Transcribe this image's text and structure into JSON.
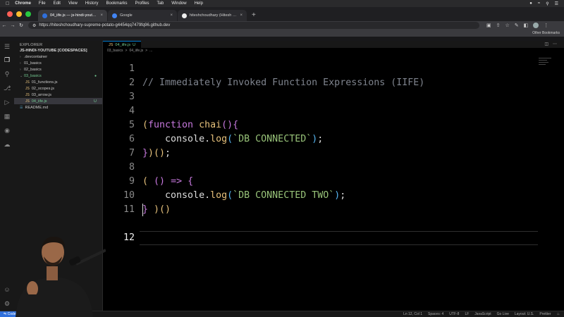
{
  "menubar": {
    "app": "Chrome",
    "items": [
      "File",
      "Edit",
      "View",
      "History",
      "Bookmarks",
      "Profiles",
      "Tab",
      "Window",
      "Help"
    ]
  },
  "tabs": [
    {
      "label": "04_iife.js — js-hindi-youtube [",
      "active": true
    },
    {
      "label": "Google",
      "active": false
    },
    {
      "label": "hiteshchoudhary (Hitesh Cho",
      "active": false
    }
  ],
  "address": {
    "url": "https://hiteshchoudhary-supreme-potato-g4454qq7479fq96.github.dev"
  },
  "bookmarks": {
    "other": "Other Bookmarks"
  },
  "explorer": {
    "title": "EXPLORER",
    "project": "JS-HINDI-YOUTUBE [CODESPACES]",
    "items": [
      {
        "label": ".devcontainer",
        "kind": "folder",
        "open": false,
        "indent": 1
      },
      {
        "label": "01_basics",
        "kind": "folder",
        "open": false,
        "indent": 1
      },
      {
        "label": "02_basics",
        "kind": "folder",
        "open": false,
        "indent": 1
      },
      {
        "label": "03_basics",
        "kind": "folder",
        "open": true,
        "indent": 1,
        "git": "green"
      },
      {
        "label": "01_functions.js",
        "kind": "file",
        "indent": 2
      },
      {
        "label": "02_scopes.js",
        "kind": "file",
        "indent": 2
      },
      {
        "label": "03_arrow.js",
        "kind": "file",
        "indent": 2
      },
      {
        "label": "04_iife.js",
        "kind": "file",
        "indent": 2,
        "selected": true,
        "badge": "U"
      },
      {
        "label": "README.md",
        "kind": "md",
        "indent": 1
      }
    ]
  },
  "editor": {
    "tab_label": "04_iife.js",
    "tab_badge": "U",
    "breadcrumb": [
      "03_basics",
      ">",
      "04_iife.js",
      ">",
      "..."
    ],
    "lines": [
      {
        "n": "1",
        "text": "// Immediately Invoked Function Expressions (IIFE)"
      },
      {
        "n": "2",
        "text": ""
      },
      {
        "n": "3",
        "text": ""
      },
      {
        "n": "4",
        "text": "(function chai(){"
      },
      {
        "n": "5",
        "text": "    console.log(`DB CONNECTED`);"
      },
      {
        "n": "6",
        "text": "})();"
      },
      {
        "n": "7",
        "text": ""
      },
      {
        "n": "8",
        "text": "( () => {"
      },
      {
        "n": "9",
        "text": "    console.log(`DB CONNECTED TWO`);"
      },
      {
        "n": "10",
        "text": "} )()"
      },
      {
        "n": "11",
        "text": ""
      },
      {
        "n": "12",
        "text": ""
      }
    ],
    "current_line": "12"
  },
  "statusbar": {
    "remote": "Codes",
    "position": "Ln 12, Col 1",
    "spaces": "Spaces: 4",
    "encoding": "UTF-8",
    "eol": "LF",
    "language": "JavaScript",
    "golive": "Go Live",
    "layout": "Layout: U.S.",
    "prettier": "Prettier"
  },
  "colors": {
    "accent": "#007acc",
    "git_untracked": "#73c991",
    "editor_bg": "#000000"
  }
}
